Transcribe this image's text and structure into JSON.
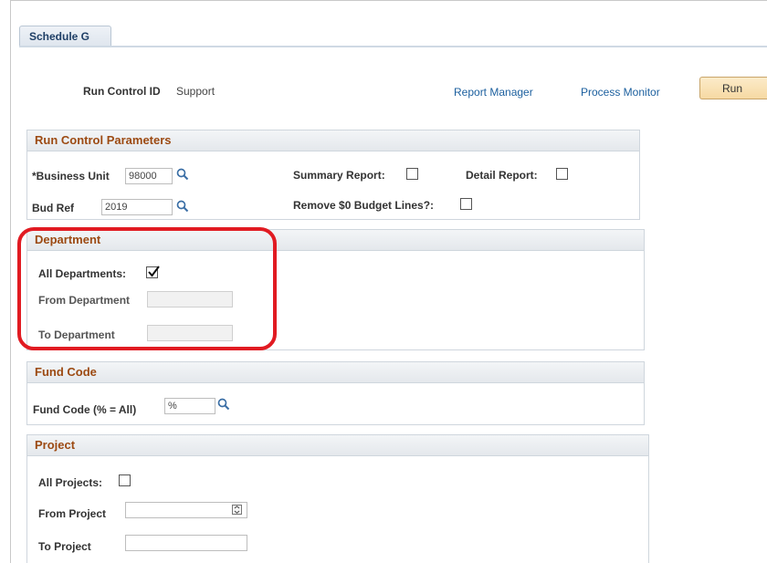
{
  "tab": {
    "label": "Schedule G"
  },
  "header": {
    "run_control_label": "Run Control ID",
    "run_control_value": "Support",
    "report_manager": "Report Manager",
    "process_monitor": "Process Monitor",
    "run_label": "Run"
  },
  "run_control_parameters": {
    "title": "Run Control Parameters",
    "business_unit_label": "*Business Unit",
    "business_unit_value": "98000",
    "bud_ref_label": "Bud Ref",
    "bud_ref_value": "2019",
    "summary_report_label": "Summary Report:",
    "summary_report_checked": false,
    "detail_report_label": "Detail Report:",
    "detail_report_checked": false,
    "remove_zero_label": "Remove $0 Budget Lines?:",
    "remove_zero_checked": false
  },
  "department": {
    "title": "Department",
    "all_departments_label": "All Departments:",
    "all_departments_checked": true,
    "from_label": "From Department",
    "from_value": "",
    "to_label": "To Department",
    "to_value": ""
  },
  "fund_code": {
    "title": "Fund Code",
    "label": "Fund Code (% = All)",
    "value": "%"
  },
  "project": {
    "title": "Project",
    "all_projects_label": "All Projects:",
    "all_projects_checked": false,
    "from_label": "From Project",
    "from_value": "",
    "to_label": "To Project",
    "to_value": ""
  },
  "colors": {
    "section_title": "#9c4a12",
    "link": "#1b5f9e",
    "highlight": "#e11b22",
    "run_button": "#f6d9a3"
  }
}
